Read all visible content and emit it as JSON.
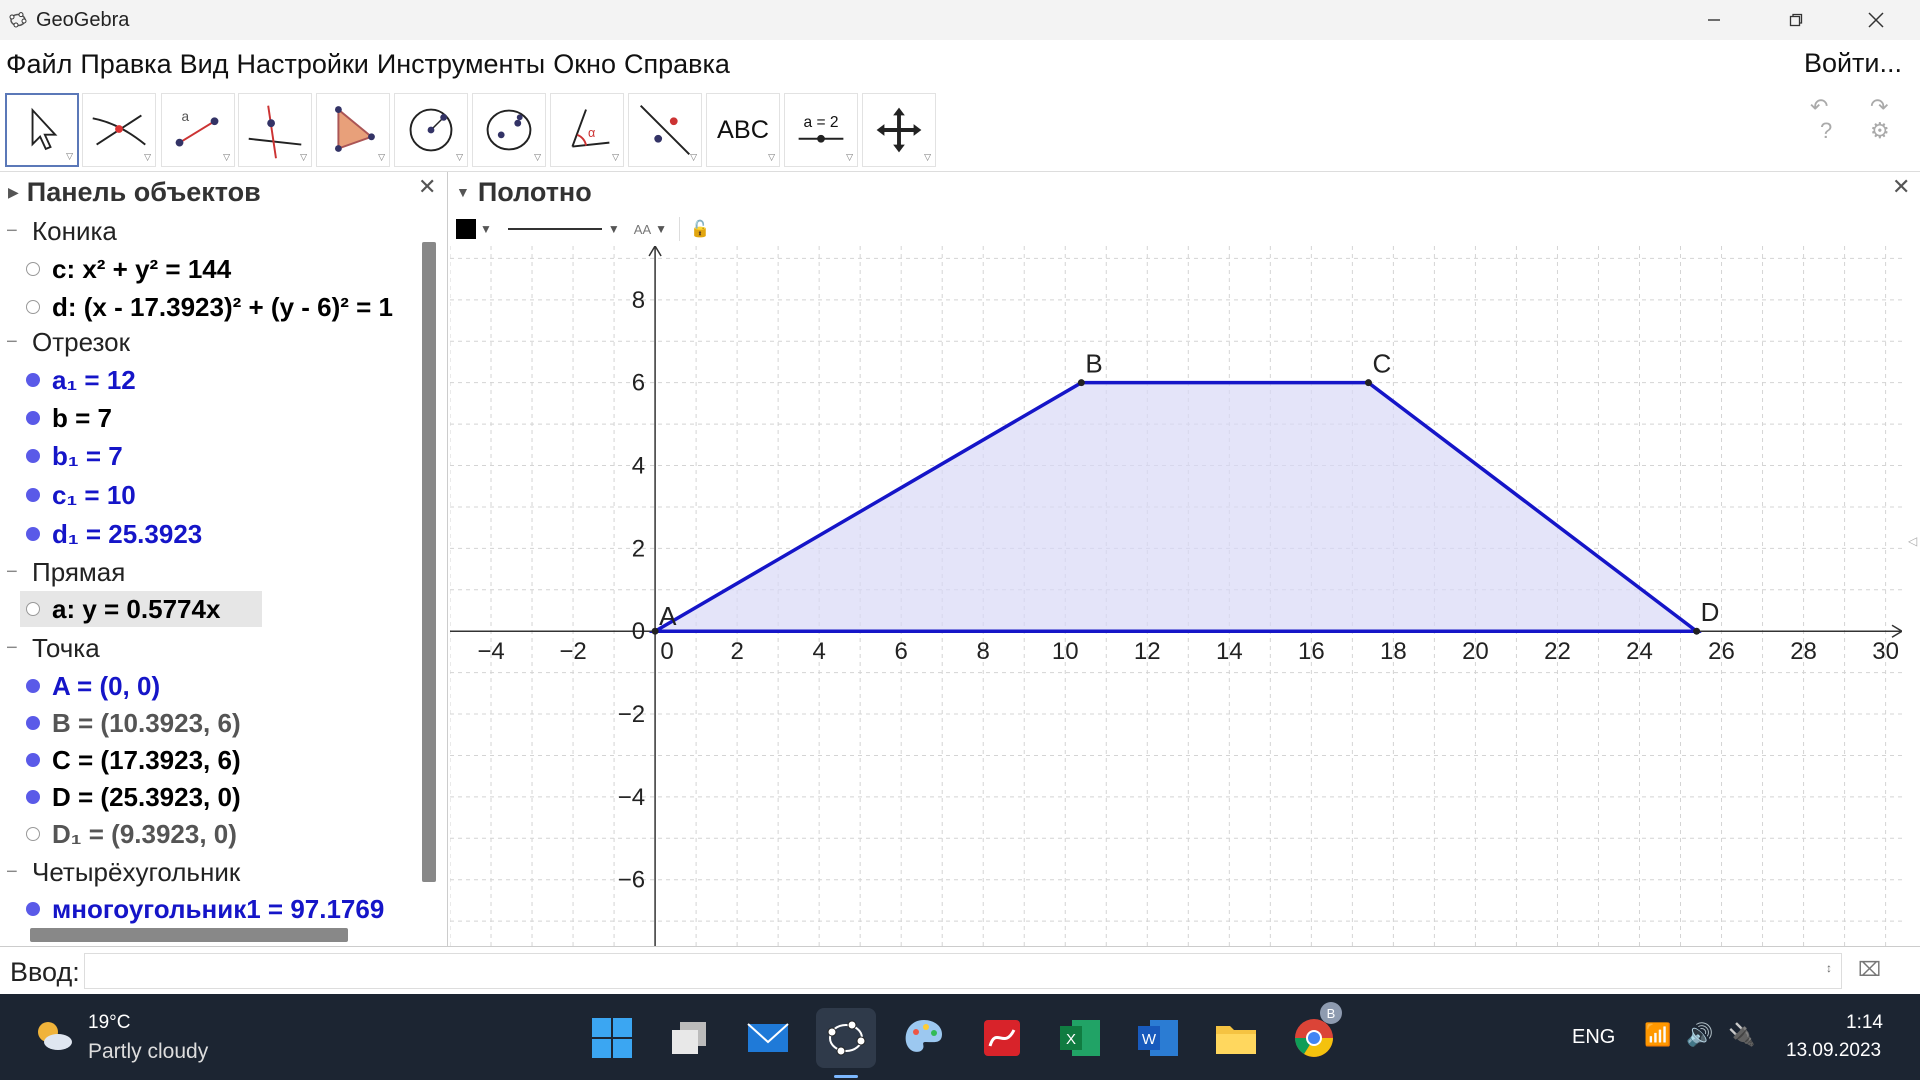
{
  "window": {
    "title": "GeoGebra"
  },
  "menu": {
    "items": [
      "Файл",
      "Правка",
      "Вид",
      "Настройки",
      "Инструменты",
      "Окно",
      "Справка"
    ],
    "login": "Войти..."
  },
  "toolbar": {
    "tools": [
      {
        "name": "move-tool"
      },
      {
        "name": "intersect-tool"
      },
      {
        "name": "segment-tool"
      },
      {
        "name": "perpendicular-tool"
      },
      {
        "name": "polygon-tool"
      },
      {
        "name": "circle-tool"
      },
      {
        "name": "ellipse-tool"
      },
      {
        "name": "angle-tool"
      },
      {
        "name": "reflect-tool"
      },
      {
        "name": "text-tool",
        "label": "ABC"
      },
      {
        "name": "slider-tool",
        "label": "a = 2"
      },
      {
        "name": "move-view-tool"
      }
    ]
  },
  "algebra": {
    "title": "Панель объектов",
    "groups": [
      {
        "label": "Коника",
        "items": [
          {
            "text": "c: x² + y² = 144",
            "color": "#000000",
            "visible": false
          },
          {
            "text": "d: (x - 17.3923)² + (y - 6)² = 1",
            "color": "#000000",
            "visible": false
          }
        ]
      },
      {
        "label": "Отрезок",
        "items": [
          {
            "text": "a₁ = 12",
            "color": "#1515c8",
            "visible": true
          },
          {
            "text": "b = 7",
            "color": "#000000",
            "visible": true
          },
          {
            "text": "b₁ = 7",
            "color": "#1515c8",
            "visible": true
          },
          {
            "text": "c₁ = 10",
            "color": "#1515c8",
            "visible": true
          },
          {
            "text": "d₁ = 25.3923",
            "color": "#1515c8",
            "visible": true
          }
        ]
      },
      {
        "label": "Прямая",
        "items": [
          {
            "text": "a: y = 0.5774x",
            "color": "#000000",
            "visible": false,
            "selected": true
          }
        ]
      },
      {
        "label": "Точка",
        "items": [
          {
            "text": "A = (0, 0)",
            "color": "#1515c8",
            "visible": true
          },
          {
            "text": "B = (10.3923, 6)",
            "color": "#555555",
            "visible": true
          },
          {
            "text": "C = (17.3923, 6)",
            "color": "#000000",
            "visible": true
          },
          {
            "text": "D = (25.3923, 0)",
            "color": "#000000",
            "visible": true
          },
          {
            "text": "D₁ = (9.3923, 0)",
            "color": "#555555",
            "visible": false
          }
        ]
      },
      {
        "label": "Четырёхугольник",
        "items": [
          {
            "text": "многоугольник1 = 97.1769",
            "color": "#1515c8",
            "visible": true
          }
        ]
      }
    ]
  },
  "graphics": {
    "title": "Полотно",
    "x_ticks": [
      "−4",
      "−2",
      "0",
      "2",
      "4",
      "6",
      "8",
      "10",
      "12",
      "14",
      "16",
      "18",
      "20",
      "22",
      "24",
      "26",
      "28",
      "30"
    ],
    "y_ticks": [
      "8",
      "6",
      "4",
      "2",
      "0",
      "−2",
      "−4",
      "−6"
    ],
    "points": [
      {
        "label": "A",
        "x": 0,
        "y": 0
      },
      {
        "label": "B",
        "x": 10.3923,
        "y": 6
      },
      {
        "label": "C",
        "x": 17.3923,
        "y": 6
      },
      {
        "label": "D",
        "x": 25.3923,
        "y": 0
      }
    ],
    "polygon_color": "#1515c8",
    "fill_color": "#d8d8f6"
  },
  "input": {
    "label": "Ввод:",
    "value": ""
  },
  "taskbar": {
    "weather": {
      "temp": "19°C",
      "desc": "Partly cloudy"
    },
    "lang": "ENG",
    "time": "1:14",
    "date": "13.09.2023",
    "chrome_badge": "B"
  }
}
